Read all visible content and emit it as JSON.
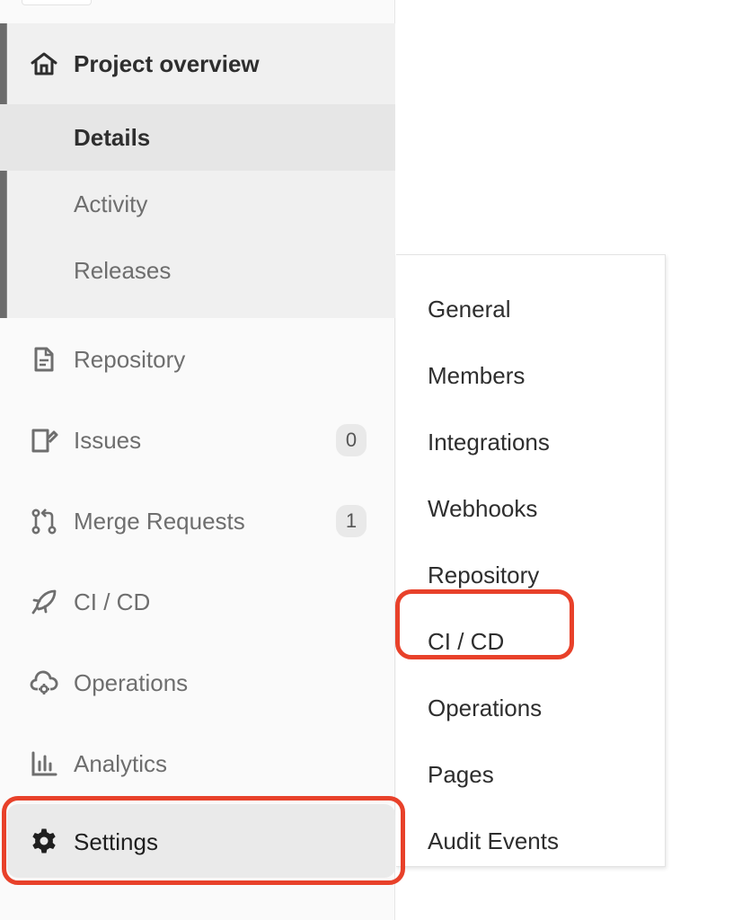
{
  "colors": {
    "accent_highlight": "#e8412a",
    "sidebar_bg": "#fafafa",
    "active_bg": "#f0f0f0",
    "text_primary": "#2e2e2e",
    "text_muted": "#6e6e6e"
  },
  "sidebar": {
    "overview": {
      "label": "Project overview",
      "icon": "home-icon",
      "subitems": [
        {
          "label": "Details",
          "active": true
        },
        {
          "label": "Activity",
          "active": false
        },
        {
          "label": "Releases",
          "active": false
        }
      ]
    },
    "items": [
      {
        "label": "Repository",
        "icon": "document-icon"
      },
      {
        "label": "Issues",
        "icon": "issues-icon",
        "badge": "0"
      },
      {
        "label": "Merge Requests",
        "icon": "merge-request-icon",
        "badge": "1"
      },
      {
        "label": "CI / CD",
        "icon": "rocket-icon"
      },
      {
        "label": "Operations",
        "icon": "cloud-gear-icon"
      },
      {
        "label": "Analytics",
        "icon": "chart-icon"
      },
      {
        "label": "Settings",
        "icon": "gear-icon"
      }
    ]
  },
  "settings_flyout": {
    "items": [
      {
        "label": "General"
      },
      {
        "label": "Members"
      },
      {
        "label": "Integrations"
      },
      {
        "label": "Webhooks"
      },
      {
        "label": "Repository"
      },
      {
        "label": "CI / CD"
      },
      {
        "label": "Operations"
      },
      {
        "label": "Pages"
      },
      {
        "label": "Audit Events"
      }
    ]
  }
}
